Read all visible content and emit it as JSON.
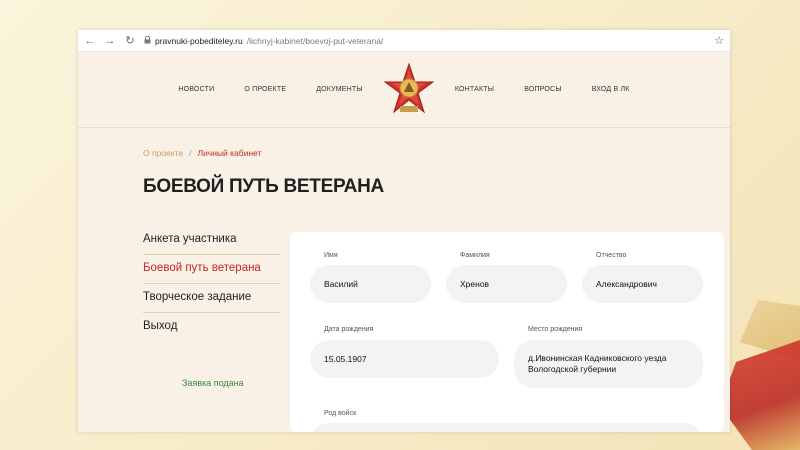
{
  "browser": {
    "back_icon": "←",
    "forward_icon": "→",
    "reload_icon": "↻",
    "url_host": "pravnuki-pobediteley.ru",
    "url_path": "/lichnyj-kabinet/boevoj-put-veterana/",
    "bookmark_icon": "☆"
  },
  "menu": {
    "left": [
      "НОВОСТИ",
      "О ПРОЕКТЕ",
      "ДОКУМЕНТЫ"
    ],
    "right": [
      "КОНТАКТЫ",
      "ВОПРОСЫ",
      "ВХОД В ЛК"
    ]
  },
  "breadcrumb": {
    "parent": "О проекте",
    "separator": "/",
    "current": "Личный кабинет"
  },
  "page_title": "БОЕВОЙ ПУТЬ ВЕТЕРАНА",
  "sidebar": {
    "items": [
      {
        "label": "Анкета участника"
      },
      {
        "label": "Боевой путь ветерана"
      },
      {
        "label": "Творческое задание"
      },
      {
        "label": "Выход"
      }
    ],
    "status": "Заявка подана"
  },
  "form": {
    "first_name": {
      "label": "Имя",
      "value": "Василий"
    },
    "last_name": {
      "label": "Фамилия",
      "value": "Хренов"
    },
    "patronymic": {
      "label": "Отчество",
      "value": "Александрович"
    },
    "birth_date": {
      "label": "Дата рождения",
      "value": "15.05.1907"
    },
    "birth_place": {
      "label": "Место рождения",
      "value_line1": "д.Ивонинская Кадниковского уезда",
      "value_line2": "Вологодской губернии"
    },
    "troops": {
      "label": "Род войск"
    }
  },
  "colors": {
    "accent_red": "#c32a22",
    "breadcrumb_gold": "#c99a5b",
    "status_green": "#3c8a3b",
    "site_bg": "#f9f1e6"
  }
}
